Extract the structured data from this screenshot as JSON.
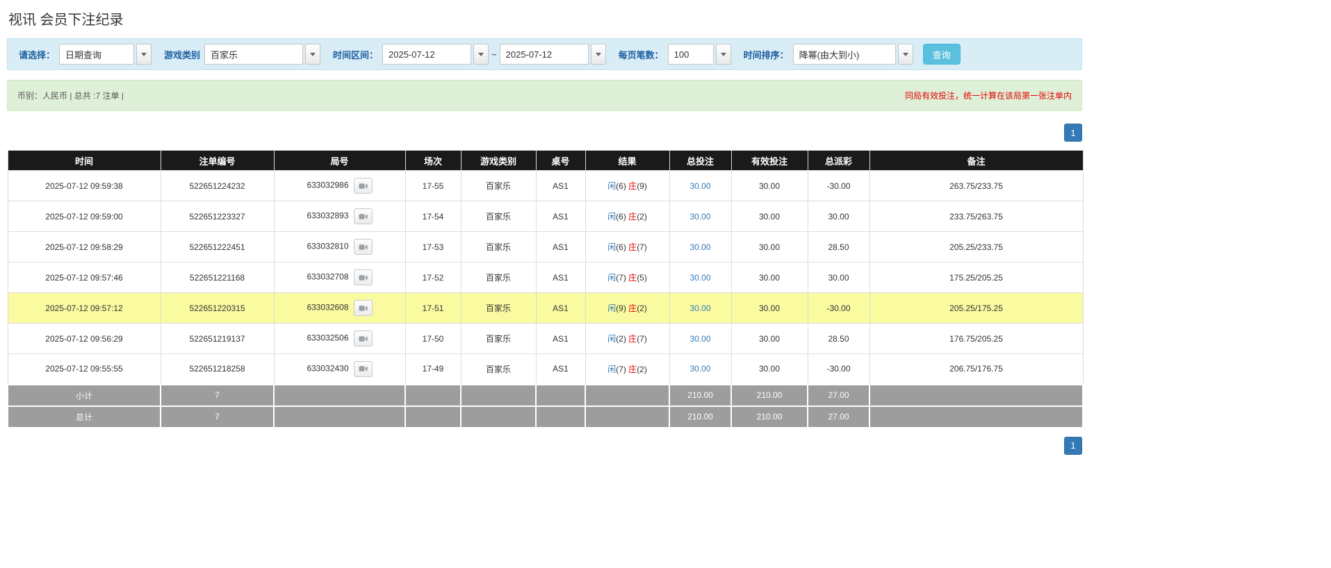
{
  "page": {
    "title": "视讯 会员下注纪录"
  },
  "colors": {
    "accent_blue": "#337ab7",
    "negative_red": "#e60000",
    "highlight_yellow": "#fafaa0",
    "header_black": "#1a1a1a",
    "footer_gray": "#9d9d9d",
    "filter_bar_blue": "#d9edf7",
    "summary_bar_green": "#dff0d8",
    "query_button_blue": "#5bc0de"
  },
  "filters": {
    "query_type": {
      "label": "请选择：",
      "value": "日期查询"
    },
    "game_type": {
      "label": "游戏类别",
      "value": "百家乐"
    },
    "time_range": {
      "label": "时间区间：",
      "from": "2025-07-12",
      "separator": "~",
      "to": "2025-07-12"
    },
    "page_size": {
      "label": "每页笔数：",
      "value": "100"
    },
    "sort": {
      "label": "时间排序：",
      "value": "降幂(由大到小)"
    },
    "search_button": "查询"
  },
  "summary": {
    "left": "币别：人民币 | 总共 :7 注单 |",
    "right": "同局有效投注，统一计算在该局第一张注单内"
  },
  "pagination": {
    "page": "1"
  },
  "table": {
    "headers": [
      "时间",
      "注单编号",
      "局号",
      "场次",
      "游戏类别",
      "桌号",
      "结果",
      "总投注",
      "有效投注",
      "总派彩",
      "备注"
    ],
    "rows": [
      {
        "time": "2025-07-12 09:59:38",
        "bet_id": "522651224232",
        "round_id": "633032986",
        "session": "17-55",
        "game_type": "百家乐",
        "table_no": "AS1",
        "player": "闲",
        "player_score": "(6)",
        "banker": "庄",
        "banker_score": "(9)",
        "total_bet": "30.00",
        "valid_bet": "30.00",
        "payout": "-30.00",
        "remark": "263.75/233.75",
        "highlighted": false
      },
      {
        "time": "2025-07-12 09:59:00",
        "bet_id": "522651223327",
        "round_id": "633032893",
        "session": "17-54",
        "game_type": "百家乐",
        "table_no": "AS1",
        "player": "闲",
        "player_score": "(6)",
        "banker": "庄",
        "banker_score": "(2)",
        "total_bet": "30.00",
        "valid_bet": "30.00",
        "payout": "30.00",
        "remark": "233.75/263.75",
        "highlighted": false
      },
      {
        "time": "2025-07-12 09:58:29",
        "bet_id": "522651222451",
        "round_id": "633032810",
        "session": "17-53",
        "game_type": "百家乐",
        "table_no": "AS1",
        "player": "闲",
        "player_score": "(6)",
        "banker": "庄",
        "banker_score": "(7)",
        "total_bet": "30.00",
        "valid_bet": "30.00",
        "payout": "28.50",
        "remark": "205.25/233.75",
        "highlighted": false
      },
      {
        "time": "2025-07-12 09:57:46",
        "bet_id": "522651221168",
        "round_id": "633032708",
        "session": "17-52",
        "game_type": "百家乐",
        "table_no": "AS1",
        "player": "闲",
        "player_score": "(7)",
        "banker": "庄",
        "banker_score": "(5)",
        "total_bet": "30.00",
        "valid_bet": "30.00",
        "payout": "30.00",
        "remark": "175.25/205.25",
        "highlighted": false
      },
      {
        "time": "2025-07-12 09:57:12",
        "bet_id": "522651220315",
        "round_id": "633032608",
        "session": "17-51",
        "game_type": "百家乐",
        "table_no": "AS1",
        "player": "闲",
        "player_score": "(9)",
        "banker": "庄",
        "banker_score": "(2)",
        "total_bet": "30.00",
        "valid_bet": "30.00",
        "payout": "-30.00",
        "remark": "205.25/175.25",
        "highlighted": true
      },
      {
        "time": "2025-07-12 09:56:29",
        "bet_id": "522651219137",
        "round_id": "633032506",
        "session": "17-50",
        "game_type": "百家乐",
        "table_no": "AS1",
        "player": "闲",
        "player_score": "(2)",
        "banker": "庄",
        "banker_score": "(7)",
        "total_bet": "30.00",
        "valid_bet": "30.00",
        "payout": "28.50",
        "remark": "176.75/205.25",
        "highlighted": false
      },
      {
        "time": "2025-07-12 09:55:55",
        "bet_id": "522651218258",
        "round_id": "633032430",
        "session": "17-49",
        "game_type": "百家乐",
        "table_no": "AS1",
        "player": "闲",
        "player_score": "(7)",
        "banker": "庄",
        "banker_score": "(2)",
        "total_bet": "30.00",
        "valid_bet": "30.00",
        "payout": "-30.00",
        "remark": "206.75/176.75",
        "highlighted": false
      }
    ],
    "subtotal": {
      "label": "小计",
      "count": "7",
      "total_bet": "210.00",
      "valid_bet": "210.00",
      "payout": "27.00"
    },
    "total": {
      "label": "总计",
      "count": "7",
      "total_bet": "210.00",
      "valid_bet": "210.00",
      "payout": "27.00"
    }
  }
}
